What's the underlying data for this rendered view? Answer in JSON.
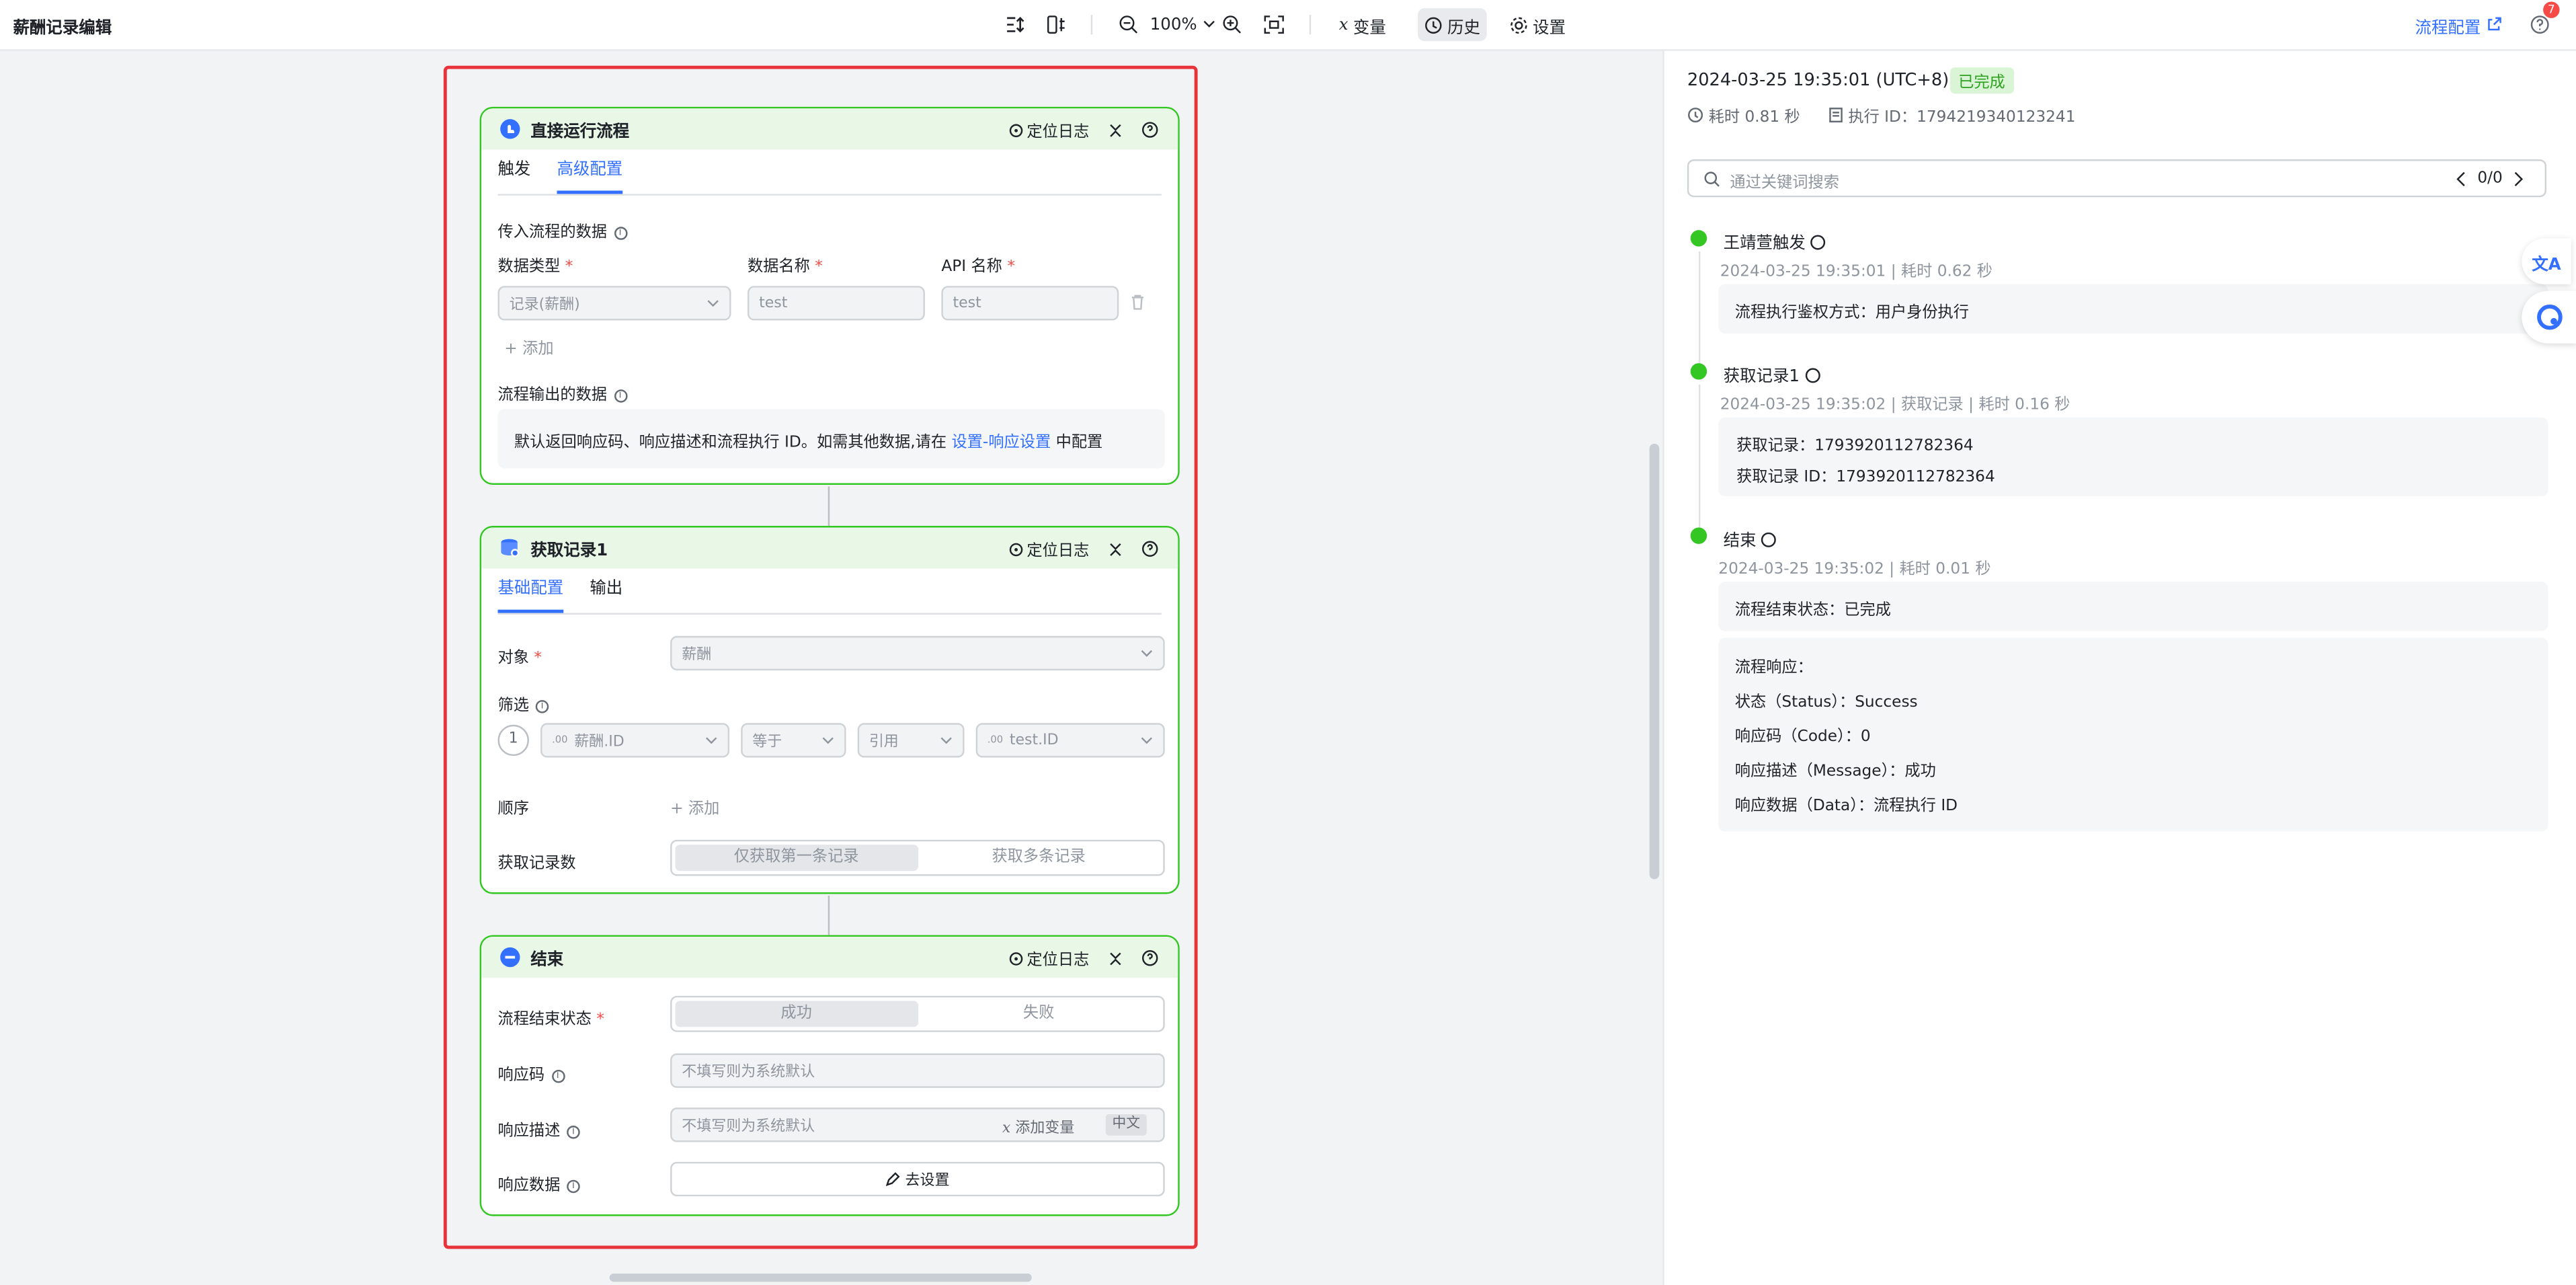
{
  "app": {
    "title": "薪酬记录编辑"
  },
  "toolbar": {
    "zoom": "100%",
    "variables": "变量",
    "history": "历史",
    "settings": "设置",
    "flow_config": "流程配置",
    "notif_count": "7"
  },
  "node1": {
    "title": "直接运行流程",
    "locate_log": "定位日志",
    "tabs": [
      "触发",
      "高级配置"
    ],
    "input_section": "传入流程的数据",
    "col_type": "数据类型",
    "col_name": "数据名称",
    "col_api": "API 名称",
    "type_value": "记录(薪酬)",
    "name_value": "test",
    "api_value": "test",
    "add": "+ 添加",
    "output_section": "流程输出的数据",
    "output_note_pre": "默认返回响应码、响应描述和流程执行 ID。如需其他数据,请在",
    "output_note_link": "设置-响应设置",
    "output_note_post": "中配置"
  },
  "node2": {
    "title": "获取记录1",
    "locate_log": "定位日志",
    "tabs": [
      "基础配置",
      "输出"
    ],
    "object_label": "对象",
    "object_value": "薪酬",
    "filter_label": "筛选",
    "filter_index": "1",
    "filter_field": "薪酬.ID",
    "filter_op": "等于",
    "filter_ref": "引用",
    "filter_target": "test.ID",
    "order_label": "顺序",
    "order_add": "+ 添加",
    "count_label": "获取记录数",
    "count_options": [
      "仅获取第一条记录",
      "获取多条记录"
    ]
  },
  "node3": {
    "title": "结束",
    "locate_log": "定位日志",
    "status_label": "流程结束状态",
    "status_options": [
      "成功",
      "失败"
    ],
    "code_label": "响应码",
    "code_placeholder": "不填写则为系统默认",
    "desc_label": "响应描述",
    "desc_placeholder": "不填写则为系统默认",
    "add_var": "添加变量",
    "lang": "中文",
    "data_label": "响应数据",
    "go_setting": "去设置"
  },
  "history": {
    "timestamp": "2024-03-25 19:35:01 (UTC+8)",
    "status": "已完成",
    "duration": "耗时 0.81 秒",
    "exec_id": "执行 ID：1794219340123241",
    "search_placeholder": "通过关键词搜索",
    "search_count": "0/0",
    "steps": [
      {
        "name": "王靖萱触发",
        "meta": "2024-03-25 19:35:01 | 耗时 0.62 秒",
        "lines": [
          "流程执行鉴权方式：用户身份执行"
        ]
      },
      {
        "name": "获取记录1",
        "meta": "2024-03-25 19:35:02 | 获取记录 | 耗时 0.16 秒",
        "lines": [
          "获取记录：1793920112782364",
          "获取记录 ID：1793920112782364"
        ]
      },
      {
        "name": "结束",
        "meta": "2024-03-25 19:35:02 | 耗时 0.01 秒",
        "lines": [
          "流程结束状态：已完成"
        ],
        "response_title": "流程响应：",
        "response_lines": [
          "状态（Status）：Success",
          "响应码（Code）：0",
          "响应描述（Message）：成功",
          "响应数据（Data）：流程执行 ID"
        ]
      }
    ]
  },
  "colors": {
    "accent": "#3370ff",
    "success": "#34c724",
    "frame": "#e8333a"
  }
}
